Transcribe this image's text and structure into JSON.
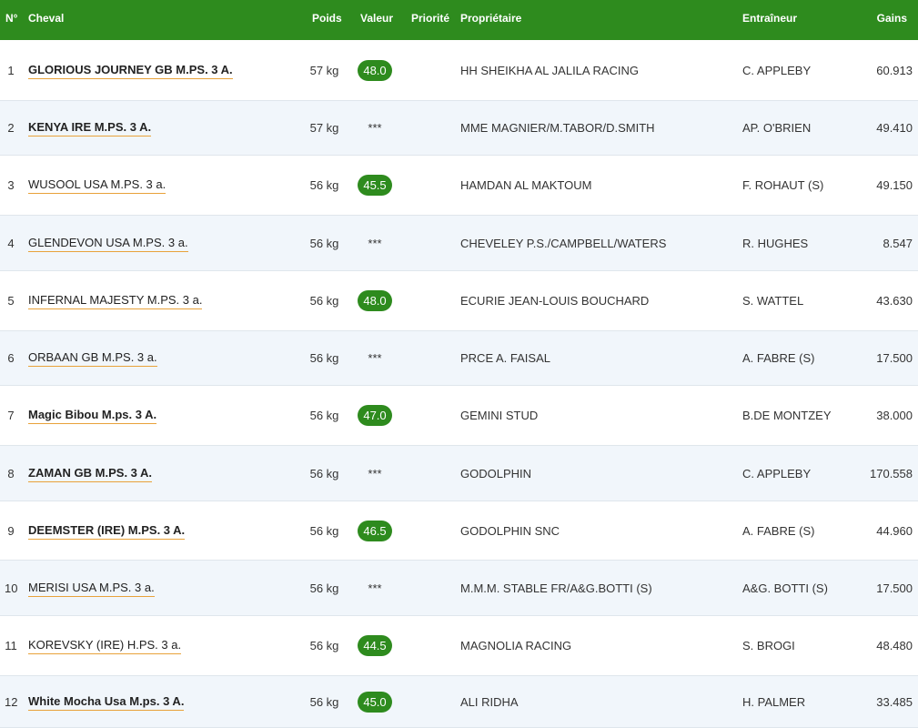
{
  "headers": {
    "num": "N°",
    "horse": "Cheval",
    "poids": "Poids",
    "valeur": "Valeur",
    "priorite": "Priorité",
    "owner": "Propriétaire",
    "trainer": "Entraîneur",
    "gains": "Gains"
  },
  "rows": [
    {
      "num": "1",
      "horse": "GLORIOUS JOURNEY GB M.PS. 3 A.",
      "bold": true,
      "poids": "57 kg",
      "valeur": "48.0",
      "owner": "HH SHEIKHA AL JALILA RACING",
      "trainer": "C. APPLEBY",
      "gains": "60.913"
    },
    {
      "num": "2",
      "horse": "KENYA IRE M.PS. 3 A.",
      "bold": true,
      "poids": "57 kg",
      "valeur": "***",
      "owner": "MME MAGNIER/M.TABOR/D.SMITH",
      "trainer": "AP. O'BRIEN",
      "gains": "49.410"
    },
    {
      "num": "3",
      "horse": "WUSOOL USA M.PS. 3 a.",
      "bold": false,
      "poids": "56 kg",
      "valeur": "45.5",
      "owner": "HAMDAN AL MAKTOUM",
      "trainer": "F. ROHAUT (S)",
      "gains": "49.150"
    },
    {
      "num": "4",
      "horse": "GLENDEVON USA M.PS. 3 a.",
      "bold": false,
      "poids": "56 kg",
      "valeur": "***",
      "owner": "CHEVELEY P.S./CAMPBELL/WATERS",
      "trainer": "R. HUGHES",
      "gains": "8.547"
    },
    {
      "num": "5",
      "horse": "INFERNAL MAJESTY M.PS. 3 a.",
      "bold": false,
      "poids": "56 kg",
      "valeur": "48.0",
      "owner": "ECURIE JEAN-LOUIS BOUCHARD",
      "trainer": "S. WATTEL",
      "gains": "43.630"
    },
    {
      "num": "6",
      "horse": "ORBAAN GB M.PS. 3 a.",
      "bold": false,
      "poids": "56 kg",
      "valeur": "***",
      "owner": "PRCE A. FAISAL",
      "trainer": "A. FABRE (S)",
      "gains": "17.500"
    },
    {
      "num": "7",
      "horse": "Magic Bibou M.ps. 3 A.",
      "bold": true,
      "poids": "56 kg",
      "valeur": "47.0",
      "owner": "GEMINI STUD",
      "trainer": "B.DE MONTZEY",
      "gains": "38.000"
    },
    {
      "num": "8",
      "horse": "ZAMAN GB M.PS. 3 A.",
      "bold": true,
      "poids": "56 kg",
      "valeur": "***",
      "owner": "GODOLPHIN",
      "trainer": "C. APPLEBY",
      "gains": "170.558"
    },
    {
      "num": "9",
      "horse": "DEEMSTER (IRE) M.PS. 3 A.",
      "bold": true,
      "poids": "56 kg",
      "valeur": "46.5",
      "owner": "GODOLPHIN SNC",
      "trainer": "A. FABRE (S)",
      "gains": "44.960"
    },
    {
      "num": "10",
      "horse": "MERISI USA M.PS. 3 a.",
      "bold": false,
      "poids": "56 kg",
      "valeur": "***",
      "owner": "M.M.M. STABLE FR/A&G.BOTTI (S)",
      "trainer": "A&G. BOTTI (S)",
      "gains": "17.500"
    },
    {
      "num": "11",
      "horse": "KOREVSKY (IRE) H.PS. 3 a.",
      "bold": false,
      "poids": "56 kg",
      "valeur": "44.5",
      "owner": "MAGNOLIA RACING",
      "trainer": "S. BROGI",
      "gains": "48.480"
    },
    {
      "num": "12",
      "horse": "White Mocha Usa M.ps. 3 A.",
      "bold": true,
      "poids": "56 kg",
      "valeur": "45.0",
      "owner": "ALI RIDHA",
      "trainer": "H. PALMER",
      "gains": "33.485"
    }
  ]
}
